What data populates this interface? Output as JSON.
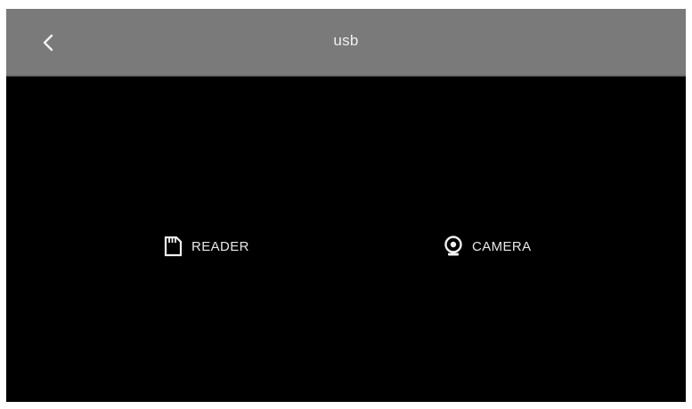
{
  "header": {
    "title": "usb",
    "back_icon": "chevron-left-icon"
  },
  "options": [
    {
      "label": "READER",
      "icon": "sd-card-icon"
    },
    {
      "label": "CAMERA",
      "icon": "webcam-icon"
    }
  ],
  "colors": {
    "titlebar": "#7a7a7a",
    "background": "#000000",
    "text": "#e8e8e8"
  }
}
